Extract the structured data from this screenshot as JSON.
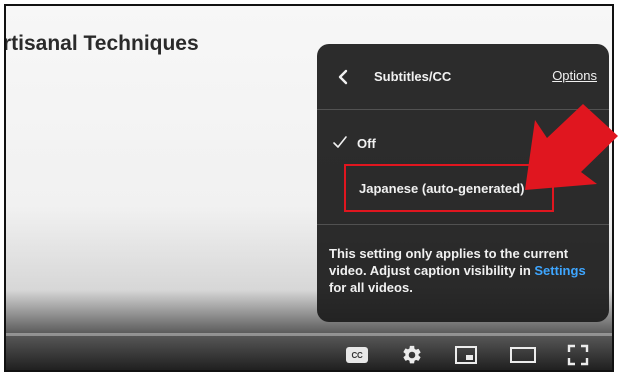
{
  "video": {
    "title": "rtisanal Techniques"
  },
  "subtitles_menu": {
    "title": "Subtitles/CC",
    "options_label": "Options",
    "items": [
      {
        "label": "Off",
        "selected": true
      },
      {
        "label": "Japanese (auto-generated)",
        "selected": false
      }
    ],
    "note_text": "This setting only applies to the current video. Adjust caption visibility in ",
    "note_link": "Settings",
    "note_suffix": " for all videos."
  },
  "controls": {
    "cc_label": "CC"
  },
  "colors": {
    "menu_bg": "#1c1c1c",
    "link_blue": "#3ea6ff",
    "annotation_red": "#e0161f"
  }
}
